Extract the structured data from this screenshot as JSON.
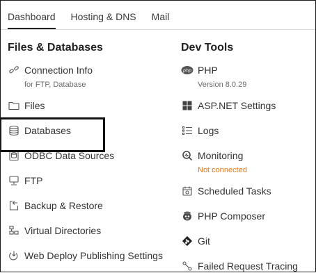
{
  "tabs": [
    {
      "label": "Dashboard",
      "active": true
    },
    {
      "label": "Hosting & DNS",
      "active": false
    },
    {
      "label": "Mail",
      "active": false
    }
  ],
  "files_databases": {
    "title": "Files & Databases",
    "items": [
      {
        "label": "Connection Info",
        "sub": "for FTP, Database",
        "icon": "link-icon"
      },
      {
        "label": "Files",
        "icon": "folder-icon"
      },
      {
        "label": "Databases",
        "icon": "database-icon"
      },
      {
        "label": "ODBC Data Sources",
        "icon": "odbc-icon"
      },
      {
        "label": "FTP",
        "icon": "ftp-icon"
      },
      {
        "label": "Backup & Restore",
        "icon": "backup-icon"
      },
      {
        "label": "Virtual Directories",
        "icon": "directories-icon"
      },
      {
        "label": "Web Deploy Publishing Settings",
        "icon": "web-deploy-icon"
      }
    ]
  },
  "dev_tools": {
    "title": "Dev Tools",
    "items": [
      {
        "label": "PHP",
        "sub": "Version 8.0.29",
        "icon": "php-icon"
      },
      {
        "label": "ASP.NET Settings",
        "icon": "windows-icon"
      },
      {
        "label": "Logs",
        "icon": "list-icon"
      },
      {
        "label": "Monitoring",
        "sub": "Not connected",
        "icon": "monitoring-icon"
      },
      {
        "label": "Scheduled Tasks",
        "icon": "calendar-icon"
      },
      {
        "label": "PHP Composer",
        "icon": "composer-icon"
      },
      {
        "label": "Git",
        "icon": "git-icon"
      },
      {
        "label": "Failed Request Tracing",
        "icon": "tracing-icon"
      }
    ]
  },
  "colors": {
    "warning": "#e0781c",
    "text": "#333333",
    "subtext": "#6a6a6a"
  }
}
